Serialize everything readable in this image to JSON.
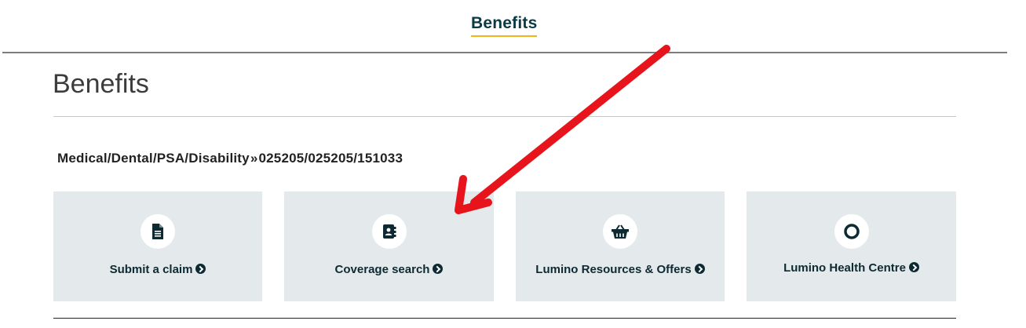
{
  "topnav": {
    "label": "Benefits"
  },
  "page": {
    "title": "Benefits"
  },
  "plan": {
    "name": "Medical/Dental/PSA/Disability",
    "separator": "»",
    "number": "025205/025205/151033"
  },
  "cards": [
    {
      "label": "Submit a claim",
      "icon": "document-icon"
    },
    {
      "label": "Coverage search",
      "icon": "contact-book-icon"
    },
    {
      "label": "Lumino Resources & Offers",
      "icon": "basket-icon"
    },
    {
      "label": "Lumino Health Centre",
      "icon": "ring-icon"
    }
  ],
  "colors": {
    "accent": "#f2b21b",
    "brand": "#0a3b45",
    "card_bg": "#e4e9eb",
    "annotation_arrow": "#e8141b"
  }
}
